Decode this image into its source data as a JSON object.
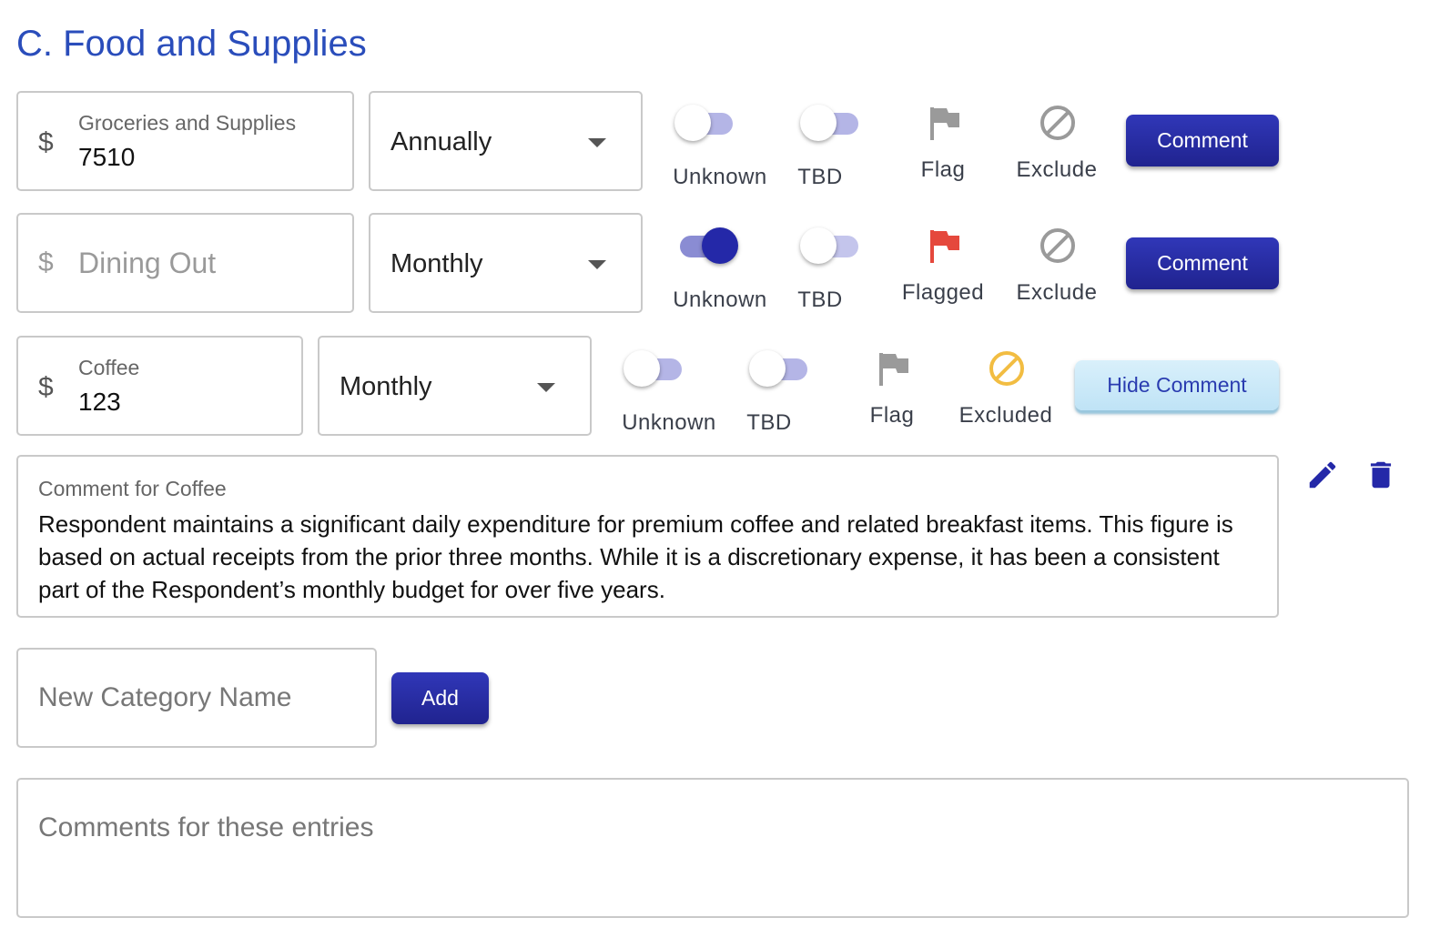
{
  "section": {
    "title": "C. Food and Supplies"
  },
  "rows": [
    {
      "currency": "$",
      "amount_label": "Groceries and Supplies",
      "amount_value": "7510",
      "frequency": "Annually",
      "unknown": {
        "label": "Unknown",
        "on": false
      },
      "tbd": {
        "label": "TBD",
        "on": false
      },
      "flag": {
        "label": "Flag",
        "state": "unflagged"
      },
      "exclude": {
        "label": "Exclude",
        "state": "not-excluded"
      },
      "comment_button": "Comment"
    },
    {
      "currency": "$",
      "amount_placeholder": "Dining Out",
      "frequency": "Monthly",
      "unknown": {
        "label": "Unknown",
        "on": true
      },
      "tbd": {
        "label": "TBD",
        "on": false
      },
      "flag": {
        "label": "Flagged",
        "state": "flagged"
      },
      "exclude": {
        "label": "Exclude",
        "state": "not-excluded"
      },
      "comment_button": "Comment"
    },
    {
      "currency": "$",
      "amount_label": "Coffee",
      "amount_value": "123",
      "frequency": "Monthly",
      "unknown": {
        "label": "Unknown",
        "on": false
      },
      "tbd": {
        "label": "TBD",
        "on": false
      },
      "flag": {
        "label": "Flag",
        "state": "unflagged"
      },
      "exclude": {
        "label": "Excluded",
        "state": "excluded"
      },
      "comment_button": "Hide Comment"
    }
  ],
  "coffee_comment": {
    "label": "Comment for Coffee",
    "text": "Respondent maintains a significant daily expenditure for premium coffee and related breakfast items. This figure is based on actual receipts from the prior three months. While it is a discretionary expense, it has been a consistent part of the Respondent’s monthly budget for over five years.",
    "icons": [
      "pencil-icon",
      "trash-icon"
    ]
  },
  "new_category": {
    "placeholder": "New Category Name",
    "add_label": "Add"
  },
  "entries_comment": {
    "placeholder": "Comments for these entries"
  },
  "colors": {
    "title": "#2a4dbb",
    "primary": "#23279a",
    "toggle_track": "#b4b5e6",
    "flag_gray": "#9a9a9a",
    "flag_red": "#e5483c",
    "exclude_gray": "#9a9a9a",
    "excluded_yellow": "#f2bd42"
  }
}
